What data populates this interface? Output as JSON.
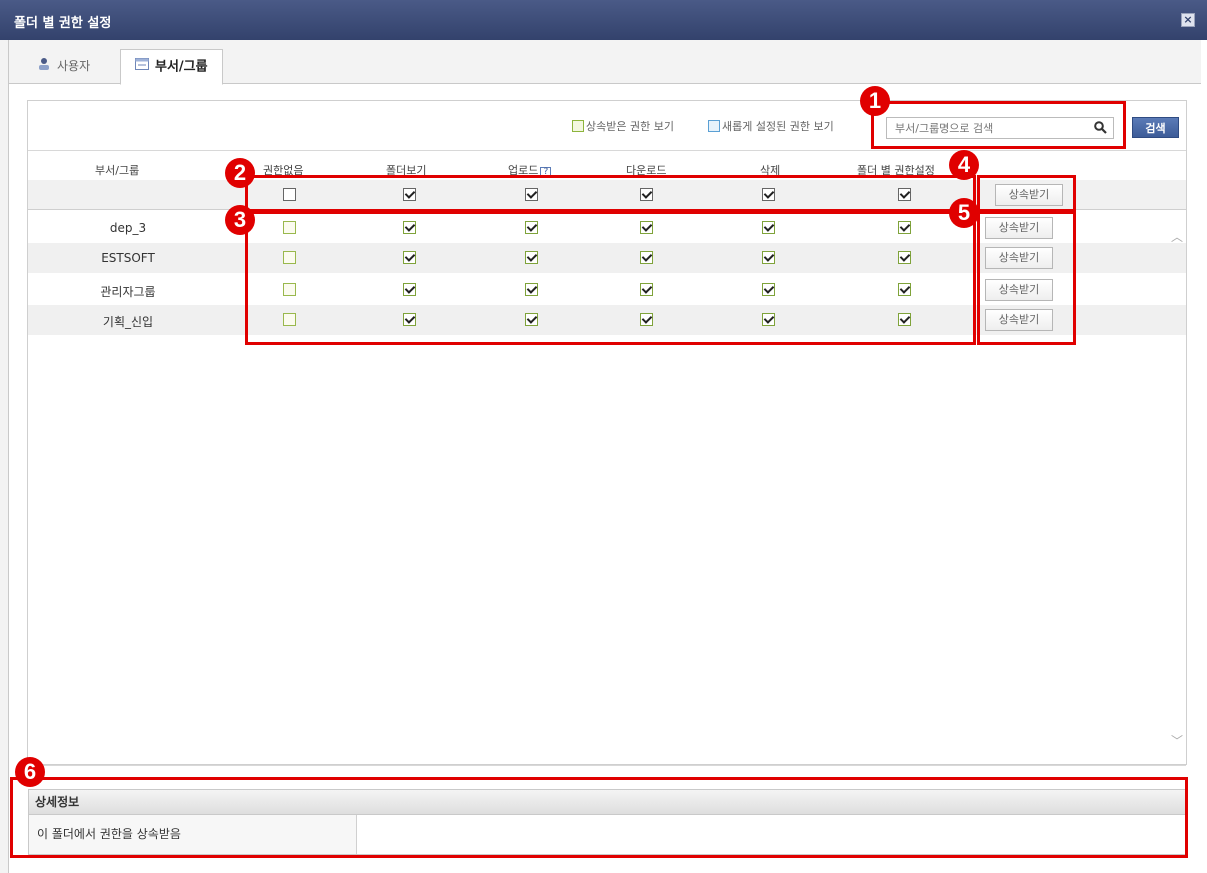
{
  "window": {
    "title": "폴더 별 권한 설정",
    "close_label": "×"
  },
  "tabs": [
    {
      "label": "사용자",
      "icon": "user-icon"
    },
    {
      "label": "부서/그룹",
      "icon": "group-icon"
    }
  ],
  "legend": {
    "inherited": "상속받은 권한 보기",
    "new": "새롭게 설정된 권한 보기",
    "inherited_color": "#8db43c",
    "new_color": "#5ba0d4"
  },
  "search": {
    "placeholder": "부서/그룹명으로 검색",
    "button": "검색"
  },
  "columns": [
    "부서/그룹",
    "권한없음",
    "폴더보기",
    "업로드",
    "다운로드",
    "삭제",
    "폴더 별 권한설정"
  ],
  "upload_help": "?",
  "header_checks": [
    false,
    true,
    true,
    true,
    true,
    true
  ],
  "inherit_label": "상속받기",
  "rows": [
    {
      "name": "dep_3",
      "checks": [
        false,
        true,
        true,
        true,
        true,
        true
      ]
    },
    {
      "name": "ESTSOFT",
      "checks": [
        false,
        true,
        true,
        true,
        true,
        true
      ]
    },
    {
      "name": "관리자그룹",
      "checks": [
        false,
        true,
        true,
        true,
        true,
        true
      ]
    },
    {
      "name": "기획_신입",
      "checks": [
        false,
        true,
        true,
        true,
        true,
        true
      ]
    }
  ],
  "badges": [
    "1",
    "2",
    "3",
    "4",
    "5",
    "6"
  ],
  "detail": {
    "title": "상세정보",
    "label": "이 폴더에서 권한을 상속받음",
    "value": ""
  },
  "accent_red": "#e00000"
}
